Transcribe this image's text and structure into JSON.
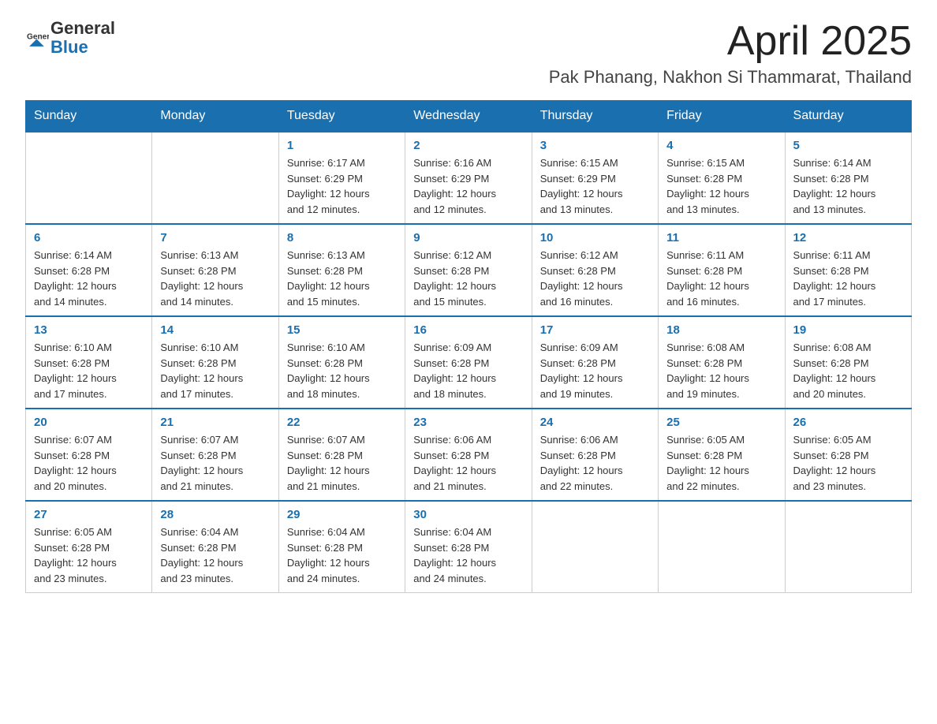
{
  "header": {
    "logo_general": "General",
    "logo_blue": "Blue",
    "month_title": "April 2025",
    "location": "Pak Phanang, Nakhon Si Thammarat, Thailand"
  },
  "weekdays": [
    "Sunday",
    "Monday",
    "Tuesday",
    "Wednesday",
    "Thursday",
    "Friday",
    "Saturday"
  ],
  "weeks": [
    [
      {
        "day": "",
        "info": ""
      },
      {
        "day": "",
        "info": ""
      },
      {
        "day": "1",
        "info": "Sunrise: 6:17 AM\nSunset: 6:29 PM\nDaylight: 12 hours\nand 12 minutes."
      },
      {
        "day": "2",
        "info": "Sunrise: 6:16 AM\nSunset: 6:29 PM\nDaylight: 12 hours\nand 12 minutes."
      },
      {
        "day": "3",
        "info": "Sunrise: 6:15 AM\nSunset: 6:29 PM\nDaylight: 12 hours\nand 13 minutes."
      },
      {
        "day": "4",
        "info": "Sunrise: 6:15 AM\nSunset: 6:28 PM\nDaylight: 12 hours\nand 13 minutes."
      },
      {
        "day": "5",
        "info": "Sunrise: 6:14 AM\nSunset: 6:28 PM\nDaylight: 12 hours\nand 13 minutes."
      }
    ],
    [
      {
        "day": "6",
        "info": "Sunrise: 6:14 AM\nSunset: 6:28 PM\nDaylight: 12 hours\nand 14 minutes."
      },
      {
        "day": "7",
        "info": "Sunrise: 6:13 AM\nSunset: 6:28 PM\nDaylight: 12 hours\nand 14 minutes."
      },
      {
        "day": "8",
        "info": "Sunrise: 6:13 AM\nSunset: 6:28 PM\nDaylight: 12 hours\nand 15 minutes."
      },
      {
        "day": "9",
        "info": "Sunrise: 6:12 AM\nSunset: 6:28 PM\nDaylight: 12 hours\nand 15 minutes."
      },
      {
        "day": "10",
        "info": "Sunrise: 6:12 AM\nSunset: 6:28 PM\nDaylight: 12 hours\nand 16 minutes."
      },
      {
        "day": "11",
        "info": "Sunrise: 6:11 AM\nSunset: 6:28 PM\nDaylight: 12 hours\nand 16 minutes."
      },
      {
        "day": "12",
        "info": "Sunrise: 6:11 AM\nSunset: 6:28 PM\nDaylight: 12 hours\nand 17 minutes."
      }
    ],
    [
      {
        "day": "13",
        "info": "Sunrise: 6:10 AM\nSunset: 6:28 PM\nDaylight: 12 hours\nand 17 minutes."
      },
      {
        "day": "14",
        "info": "Sunrise: 6:10 AM\nSunset: 6:28 PM\nDaylight: 12 hours\nand 17 minutes."
      },
      {
        "day": "15",
        "info": "Sunrise: 6:10 AM\nSunset: 6:28 PM\nDaylight: 12 hours\nand 18 minutes."
      },
      {
        "day": "16",
        "info": "Sunrise: 6:09 AM\nSunset: 6:28 PM\nDaylight: 12 hours\nand 18 minutes."
      },
      {
        "day": "17",
        "info": "Sunrise: 6:09 AM\nSunset: 6:28 PM\nDaylight: 12 hours\nand 19 minutes."
      },
      {
        "day": "18",
        "info": "Sunrise: 6:08 AM\nSunset: 6:28 PM\nDaylight: 12 hours\nand 19 minutes."
      },
      {
        "day": "19",
        "info": "Sunrise: 6:08 AM\nSunset: 6:28 PM\nDaylight: 12 hours\nand 20 minutes."
      }
    ],
    [
      {
        "day": "20",
        "info": "Sunrise: 6:07 AM\nSunset: 6:28 PM\nDaylight: 12 hours\nand 20 minutes."
      },
      {
        "day": "21",
        "info": "Sunrise: 6:07 AM\nSunset: 6:28 PM\nDaylight: 12 hours\nand 21 minutes."
      },
      {
        "day": "22",
        "info": "Sunrise: 6:07 AM\nSunset: 6:28 PM\nDaylight: 12 hours\nand 21 minutes."
      },
      {
        "day": "23",
        "info": "Sunrise: 6:06 AM\nSunset: 6:28 PM\nDaylight: 12 hours\nand 21 minutes."
      },
      {
        "day": "24",
        "info": "Sunrise: 6:06 AM\nSunset: 6:28 PM\nDaylight: 12 hours\nand 22 minutes."
      },
      {
        "day": "25",
        "info": "Sunrise: 6:05 AM\nSunset: 6:28 PM\nDaylight: 12 hours\nand 22 minutes."
      },
      {
        "day": "26",
        "info": "Sunrise: 6:05 AM\nSunset: 6:28 PM\nDaylight: 12 hours\nand 23 minutes."
      }
    ],
    [
      {
        "day": "27",
        "info": "Sunrise: 6:05 AM\nSunset: 6:28 PM\nDaylight: 12 hours\nand 23 minutes."
      },
      {
        "day": "28",
        "info": "Sunrise: 6:04 AM\nSunset: 6:28 PM\nDaylight: 12 hours\nand 23 minutes."
      },
      {
        "day": "29",
        "info": "Sunrise: 6:04 AM\nSunset: 6:28 PM\nDaylight: 12 hours\nand 24 minutes."
      },
      {
        "day": "30",
        "info": "Sunrise: 6:04 AM\nSunset: 6:28 PM\nDaylight: 12 hours\nand 24 minutes."
      },
      {
        "day": "",
        "info": ""
      },
      {
        "day": "",
        "info": ""
      },
      {
        "day": "",
        "info": ""
      }
    ]
  ]
}
